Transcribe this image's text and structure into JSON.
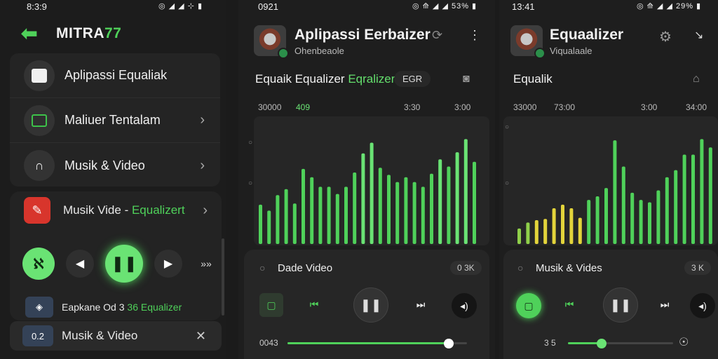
{
  "colors": {
    "accent": "#4fd15a",
    "accent_light": "#6ae374",
    "red": "#d8352c",
    "yellow": "#e3d43b",
    "bg": "#1c1c1c"
  },
  "screen1": {
    "status_time": "8:3:9",
    "status_icons": "◎ ◢ ◢ ⊹ ▮",
    "header": {
      "title_main": "MITRA",
      "title_accent": "77",
      "back_icon": "back-arrow-icon"
    },
    "menu": [
      {
        "label": "Aplipassi Equaliak",
        "icon": "image-icon"
      },
      {
        "label": "Maliuer Tentalam",
        "icon": "list-icon"
      },
      {
        "label": "Musik & Video",
        "icon": "headphones-icon"
      }
    ],
    "player": {
      "row_label_main": "Musik Vide",
      "row_label_accent": "Equalizert",
      "bottom_main": "Eapkane Od 3 ",
      "bottom_accent": "36 Equalizer",
      "strip_thumb": "0.2",
      "strip_label": "Musik & Video"
    }
  },
  "screen2": {
    "status_time": "0921",
    "status_right": "◎ ⟰ ◢ ◢ 53% ▮",
    "title": "Aplipassi Eerbaizer",
    "subtitle": "Ohenbeaole",
    "eq_main": "Equaik Equalizer ",
    "eq_accent": "Eqralizer",
    "pill": "EGR",
    "ticks": [
      "30000",
      "409",
      "3:30",
      "3:00"
    ],
    "player_title": "Dade Video",
    "player_pill": "0 3K",
    "time_current": "0043",
    "progress": 0.9
  },
  "screen3": {
    "status_time": "13:41",
    "status_right": "◎ ⟰ ◢ ◢ 29% ▮",
    "title": "Equaalizer",
    "subtitle": "Viqualaale",
    "eq_label": "Equalik",
    "ticks": [
      "33000",
      "73:00",
      "3:00",
      "34:00"
    ],
    "player_title": "Musik & Vides",
    "player_pill": "3 K",
    "time_current": "3 5",
    "progress": 0.32
  },
  "chart_data": [
    {
      "type": "bar",
      "title": "",
      "values": [
        0.33,
        0.28,
        0.41,
        0.46,
        0.34,
        0.63,
        0.56,
        0.48,
        0.48,
        0.42,
        0.48,
        0.6,
        0.76,
        0.85,
        0.64,
        0.58,
        0.52,
        0.56,
        0.52,
        0.48,
        0.59,
        0.71,
        0.65,
        0.77,
        0.88,
        0.69
      ],
      "colors": "green"
    },
    {
      "type": "bar",
      "title": "",
      "values": [
        0.13,
        0.18,
        0.2,
        0.21,
        0.3,
        0.33,
        0.3,
        0.22,
        0.37,
        0.4,
        0.47,
        0.87,
        0.65,
        0.43,
        0.37,
        0.35,
        0.45,
        0.56,
        0.62,
        0.75,
        0.75,
        0.88,
        0.81
      ],
      "colors": "yellow-green"
    }
  ]
}
